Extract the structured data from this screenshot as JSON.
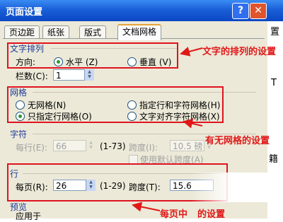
{
  "dialog": {
    "title": "页面设置",
    "help_glyph": "?",
    "close_glyph": "✕"
  },
  "tabs": [
    "页边距",
    "纸张",
    "版式",
    "文档网格"
  ],
  "text_direction": {
    "title": "文字排列",
    "direction_label": "方向:",
    "horizontal": "水平",
    "horizontal_key": "(Z)",
    "vertical": "垂直",
    "vertical_key": "(V)",
    "selected": "水平",
    "columns_label": "栏数",
    "columns_key": "(C):",
    "columns_value": "1"
  },
  "grid": {
    "title": "网格",
    "no_grid": "无网格",
    "no_grid_key": "(N)",
    "specify_line_char": "指定行和字符网格",
    "specify_line_char_key": "(H)",
    "line_only": "只指定行网格",
    "line_only_key": "(O)",
    "align_to_char": "文字对齐字符网格",
    "align_to_char_key": "(X)",
    "selected": "只指定行网格"
  },
  "characters": {
    "title": "字符",
    "per_line_label": "每行",
    "per_line_key": "(E):",
    "per_line_value": "66",
    "per_line_range": "(1-73)",
    "pitch_label": "跨度",
    "pitch_key": "(I):",
    "pitch_value": "10.5 磅",
    "use_default_pitch": "使用默认跨度",
    "use_default_pitch_key": "(A)"
  },
  "lines": {
    "title": "行",
    "per_page_label": "每页",
    "per_page_key": "(R):",
    "per_page_value": "26",
    "per_page_range": "(1-29)",
    "pitch_label": "跨度",
    "pitch_key": "(T):",
    "pitch_value": "15.6"
  },
  "preview": {
    "title": "预览",
    "apply_to_label": "应用于"
  },
  "annotations": {
    "text_direction": "文字的排列的设置",
    "grid": "有无网格的设置",
    "lines": "每页中",
    "lines_tail": "的设置",
    "color": "#e01818"
  },
  "gutter_chars": [
    "置",
    "T",
    "籍"
  ]
}
